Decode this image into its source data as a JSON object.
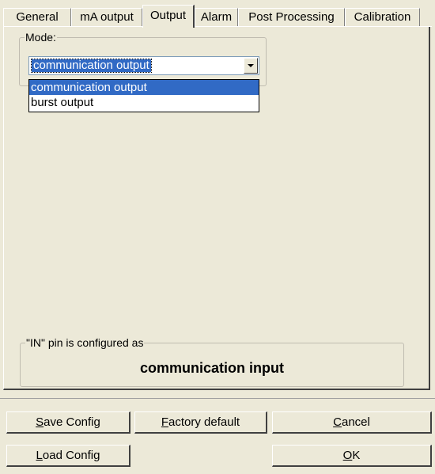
{
  "tabs": [
    {
      "label": "General"
    },
    {
      "label": "mA output"
    },
    {
      "label": "Output"
    },
    {
      "label": "Alarm"
    },
    {
      "label": "Post Processing"
    },
    {
      "label": "Calibration"
    }
  ],
  "mode_group": {
    "legend": "Mode:",
    "selected_value": "communication output",
    "options": [
      "communication output",
      "burst output"
    ]
  },
  "in_pin_group": {
    "legend": "\"IN\" pin is configured as",
    "value": "communication input"
  },
  "buttons": {
    "save_config": {
      "mnemonic": "S",
      "rest": "ave Config"
    },
    "factory_default": {
      "mnemonic": "F",
      "rest": "actory default"
    },
    "cancel": {
      "mnemonic": "C",
      "rest": "ancel"
    },
    "load_config": {
      "mnemonic": "L",
      "rest": "oad Config"
    },
    "ok": {
      "mnemonic": "O",
      "rest": "K"
    }
  },
  "colors": {
    "dialog_bg": "#ece9d8",
    "selection": "#316ac5"
  }
}
